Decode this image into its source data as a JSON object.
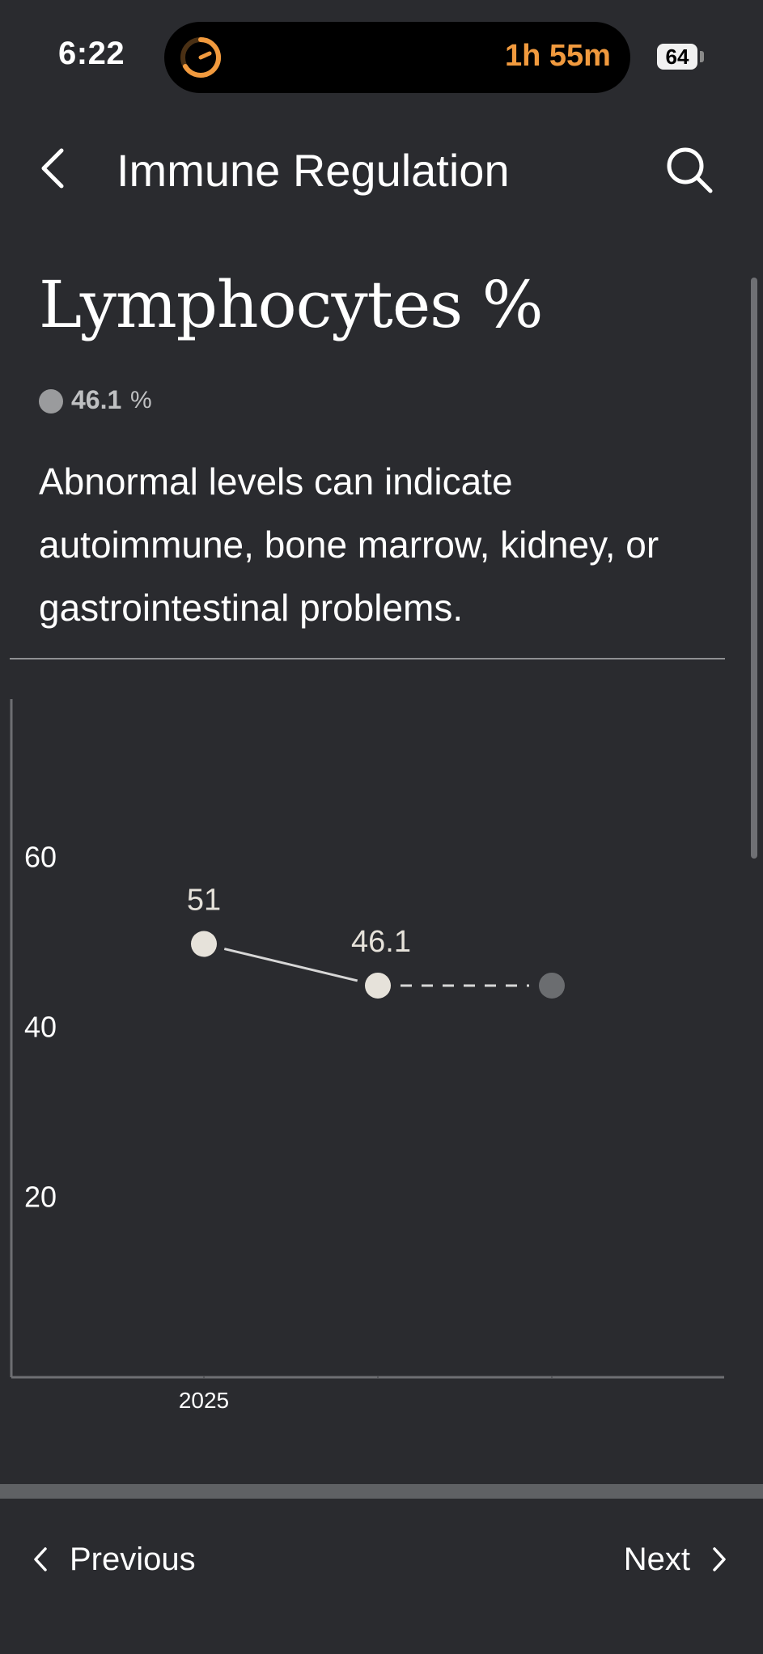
{
  "status_bar": {
    "time": "6:22",
    "activity_text": "1h 55m",
    "battery": "64",
    "accent": "#f19a3e"
  },
  "nav": {
    "title": "Immune Regulation",
    "back_icon": "chevron-left-icon",
    "search_icon": "search-icon"
  },
  "marker": {
    "name": "Lymphocytes %",
    "latest_value": "46.1",
    "latest_unit": "%",
    "description": "Abnormal levels can indicate autoimmune, bone marrow, kidney, or gastrointestinal problems."
  },
  "chart_data": {
    "type": "line",
    "y_ticks": [
      20,
      40,
      60
    ],
    "ylim": [
      0,
      80
    ],
    "x_tick_label": "2025",
    "points": [
      {
        "value": 51,
        "label": "51"
      },
      {
        "value": 46.1,
        "label": "46.1"
      }
    ],
    "projection": {
      "value": 46.1,
      "style": "dashed"
    },
    "grid": false
  },
  "footer": {
    "previous_label": "Previous",
    "next_label": "Next"
  }
}
